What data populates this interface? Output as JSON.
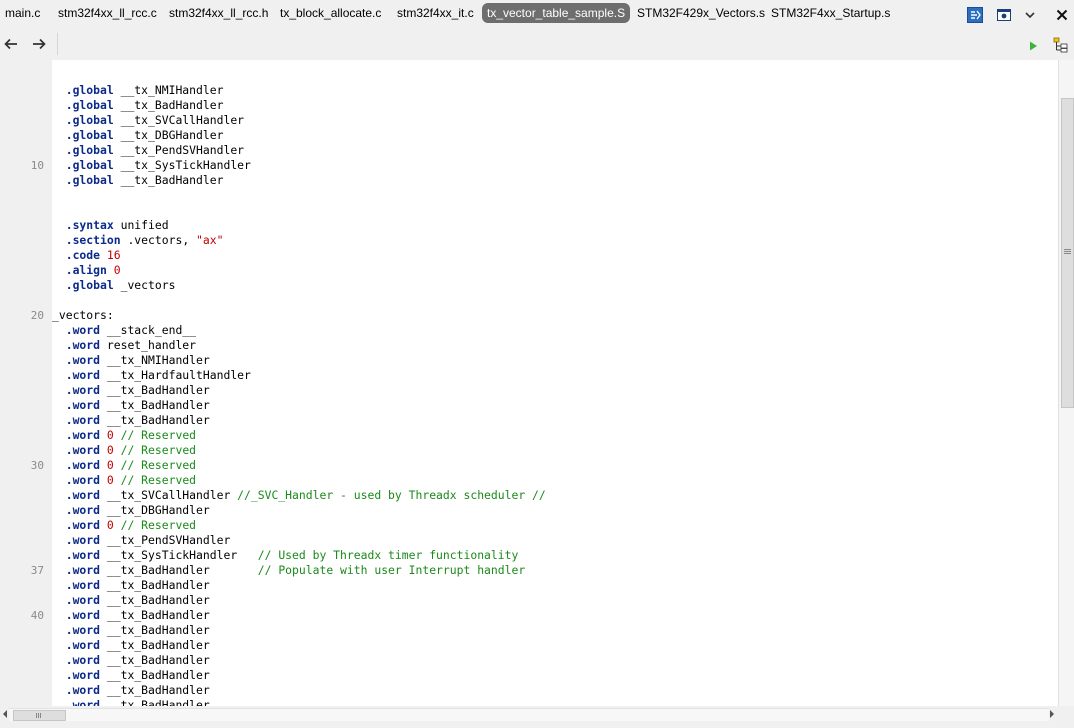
{
  "tabs": [
    {
      "label": "main.c",
      "active": false
    },
    {
      "label": "stm32f4xx_ll_rcc.c",
      "active": false
    },
    {
      "label": "stm32f4xx_ll_rcc.h",
      "active": false
    },
    {
      "label": "tx_block_allocate.c",
      "active": false
    },
    {
      "label": "stm32f4xx_it.c",
      "active": false
    },
    {
      "label": "tx_vector_table_sample.S",
      "active": true
    },
    {
      "label": "STM32F429x_Vectors.s",
      "active": false
    },
    {
      "label": "STM32F4xx_Startup.s",
      "active": false
    }
  ],
  "toolbar": {
    "back_icon": "arrow-left-icon",
    "forward_icon": "arrow-right-icon",
    "run_icon": "play-icon",
    "tree_icon": "tree-icon",
    "overflow_icon": "chevron-down-icon",
    "close_icon": "close-icon",
    "colors": {
      "run": "#3cb43c",
      "active_tab": "#6e6e6e"
    }
  },
  "editor": {
    "lines": [
      {
        "n": "",
        "t": []
      },
      {
        "n": "",
        "t": [
          {
            "c": "  "
          },
          {
            "k": "kw",
            "c": ".global"
          },
          {
            "c": " __tx_NMIHandler"
          }
        ]
      },
      {
        "n": "",
        "t": [
          {
            "c": "  "
          },
          {
            "k": "kw",
            "c": ".global"
          },
          {
            "c": " __tx_BadHandler"
          }
        ]
      },
      {
        "n": "",
        "t": [
          {
            "c": "  "
          },
          {
            "k": "kw",
            "c": ".global"
          },
          {
            "c": " __tx_SVCallHandler"
          }
        ]
      },
      {
        "n": "",
        "t": [
          {
            "c": "  "
          },
          {
            "k": "kw",
            "c": ".global"
          },
          {
            "c": " __tx_DBGHandler"
          }
        ]
      },
      {
        "n": "",
        "t": [
          {
            "c": "  "
          },
          {
            "k": "kw",
            "c": ".global"
          },
          {
            "c": " __tx_PendSVHandler"
          }
        ]
      },
      {
        "n": "10",
        "t": [
          {
            "c": "  "
          },
          {
            "k": "kw",
            "c": ".global"
          },
          {
            "c": " __tx_SysTickHandler"
          }
        ]
      },
      {
        "n": "",
        "t": [
          {
            "c": "  "
          },
          {
            "k": "kw",
            "c": ".global"
          },
          {
            "c": " __tx_BadHandler"
          }
        ]
      },
      {
        "n": "",
        "t": []
      },
      {
        "n": "",
        "t": []
      },
      {
        "n": "",
        "t": [
          {
            "c": "  "
          },
          {
            "k": "kw",
            "c": ".syntax"
          },
          {
            "c": " unified"
          }
        ]
      },
      {
        "n": "",
        "t": [
          {
            "c": "  "
          },
          {
            "k": "kw",
            "c": ".section"
          },
          {
            "c": " .vectors, "
          },
          {
            "k": "str",
            "c": "\"ax\""
          }
        ]
      },
      {
        "n": "",
        "t": [
          {
            "c": "  "
          },
          {
            "k": "kw",
            "c": ".code"
          },
          {
            "c": " "
          },
          {
            "k": "num",
            "c": "16"
          }
        ]
      },
      {
        "n": "",
        "t": [
          {
            "c": "  "
          },
          {
            "k": "kw",
            "c": ".align"
          },
          {
            "c": " "
          },
          {
            "k": "num",
            "c": "0"
          }
        ]
      },
      {
        "n": "",
        "t": [
          {
            "c": "  "
          },
          {
            "k": "kw",
            "c": ".global"
          },
          {
            "c": " _vectors"
          }
        ]
      },
      {
        "n": "",
        "t": []
      },
      {
        "n": "20",
        "t": [
          {
            "c": "_vectors:"
          }
        ]
      },
      {
        "n": "",
        "t": [
          {
            "c": "  "
          },
          {
            "k": "kw",
            "c": ".word"
          },
          {
            "c": " __stack_end__"
          }
        ]
      },
      {
        "n": "",
        "t": [
          {
            "c": "  "
          },
          {
            "k": "kw",
            "c": ".word"
          },
          {
            "c": " reset_handler"
          }
        ]
      },
      {
        "n": "",
        "t": [
          {
            "c": "  "
          },
          {
            "k": "kw",
            "c": ".word"
          },
          {
            "c": " __tx_NMIHandler"
          }
        ]
      },
      {
        "n": "",
        "t": [
          {
            "c": "  "
          },
          {
            "k": "kw",
            "c": ".word"
          },
          {
            "c": " __tx_HardfaultHandler"
          }
        ]
      },
      {
        "n": "",
        "t": [
          {
            "c": "  "
          },
          {
            "k": "kw",
            "c": ".word"
          },
          {
            "c": " __tx_BadHandler"
          }
        ]
      },
      {
        "n": "",
        "t": [
          {
            "c": "  "
          },
          {
            "k": "kw",
            "c": ".word"
          },
          {
            "c": " __tx_BadHandler"
          }
        ]
      },
      {
        "n": "",
        "t": [
          {
            "c": "  "
          },
          {
            "k": "kw",
            "c": ".word"
          },
          {
            "c": " __tx_BadHandler"
          }
        ]
      },
      {
        "n": "",
        "t": [
          {
            "c": "  "
          },
          {
            "k": "kw",
            "c": ".word"
          },
          {
            "c": " "
          },
          {
            "k": "num",
            "c": "0"
          },
          {
            "c": " "
          },
          {
            "k": "cmt",
            "c": "// Reserved"
          }
        ]
      },
      {
        "n": "",
        "t": [
          {
            "c": "  "
          },
          {
            "k": "kw",
            "c": ".word"
          },
          {
            "c": " "
          },
          {
            "k": "num",
            "c": "0"
          },
          {
            "c": " "
          },
          {
            "k": "cmt",
            "c": "// Reserved"
          }
        ]
      },
      {
        "n": "30",
        "t": [
          {
            "c": "  "
          },
          {
            "k": "kw",
            "c": ".word"
          },
          {
            "c": " "
          },
          {
            "k": "num",
            "c": "0"
          },
          {
            "c": " "
          },
          {
            "k": "cmt",
            "c": "// Reserved"
          }
        ]
      },
      {
        "n": "",
        "t": [
          {
            "c": "  "
          },
          {
            "k": "kw",
            "c": ".word"
          },
          {
            "c": " "
          },
          {
            "k": "num",
            "c": "0"
          },
          {
            "c": " "
          },
          {
            "k": "cmt",
            "c": "// Reserved"
          }
        ]
      },
      {
        "n": "",
        "t": [
          {
            "c": "  "
          },
          {
            "k": "kw",
            "c": ".word"
          },
          {
            "c": " __tx_SVCallHandler "
          },
          {
            "k": "cmt",
            "c": "//_SVC_Handler - used by Threadx scheduler //"
          }
        ]
      },
      {
        "n": "",
        "t": [
          {
            "c": "  "
          },
          {
            "k": "kw",
            "c": ".word"
          },
          {
            "c": " __tx_DBGHandler"
          }
        ]
      },
      {
        "n": "",
        "t": [
          {
            "c": "  "
          },
          {
            "k": "kw",
            "c": ".word"
          },
          {
            "c": " "
          },
          {
            "k": "num",
            "c": "0"
          },
          {
            "c": " "
          },
          {
            "k": "cmt",
            "c": "// Reserved"
          }
        ]
      },
      {
        "n": "",
        "t": [
          {
            "c": "  "
          },
          {
            "k": "kw",
            "c": ".word"
          },
          {
            "c": " __tx_PendSVHandler"
          }
        ]
      },
      {
        "n": "",
        "t": [
          {
            "c": "  "
          },
          {
            "k": "kw",
            "c": ".word"
          },
          {
            "c": " __tx_SysTickHandler   "
          },
          {
            "k": "cmt",
            "c": "// Used by Threadx timer functionality"
          }
        ]
      },
      {
        "n": "37",
        "t": [
          {
            "c": "  "
          },
          {
            "k": "kw",
            "c": ".word"
          },
          {
            "c": " __tx_BadHandler       "
          },
          {
            "k": "cmt",
            "c": "// Populate with user Interrupt handler"
          }
        ]
      },
      {
        "n": "",
        "t": [
          {
            "c": "  "
          },
          {
            "k": "kw",
            "c": ".word"
          },
          {
            "c": " __tx_BadHandler"
          }
        ]
      },
      {
        "n": "",
        "t": [
          {
            "c": "  "
          },
          {
            "k": "kw",
            "c": ".word"
          },
          {
            "c": " __tx_BadHandler"
          }
        ]
      },
      {
        "n": "40",
        "t": [
          {
            "c": "  "
          },
          {
            "k": "kw",
            "c": ".word"
          },
          {
            "c": " __tx_BadHandler"
          }
        ]
      },
      {
        "n": "",
        "t": [
          {
            "c": "  "
          },
          {
            "k": "kw",
            "c": ".word"
          },
          {
            "c": " __tx_BadHandler"
          }
        ]
      },
      {
        "n": "",
        "t": [
          {
            "c": "  "
          },
          {
            "k": "kw",
            "c": ".word"
          },
          {
            "c": " __tx_BadHandler"
          }
        ]
      },
      {
        "n": "",
        "t": [
          {
            "c": "  "
          },
          {
            "k": "kw",
            "c": ".word"
          },
          {
            "c": " __tx_BadHandler"
          }
        ]
      },
      {
        "n": "",
        "t": [
          {
            "c": "  "
          },
          {
            "k": "kw",
            "c": ".word"
          },
          {
            "c": " __tx_BadHandler"
          }
        ]
      },
      {
        "n": "",
        "t": [
          {
            "c": "  "
          },
          {
            "k": "kw",
            "c": ".word"
          },
          {
            "c": " __tx_BadHandler"
          }
        ]
      },
      {
        "n": "",
        "t": [
          {
            "c": "  "
          },
          {
            "k": "kw",
            "c": ".word"
          },
          {
            "c": " __tx_BadHandler"
          }
        ]
      }
    ]
  },
  "scrollbars": {
    "vertical_position": 0.06,
    "horizontal_position": 0.0,
    "left_arrow_icon": "arrow-left-small-icon",
    "right_arrow_icon": "arrow-right-small-icon"
  }
}
